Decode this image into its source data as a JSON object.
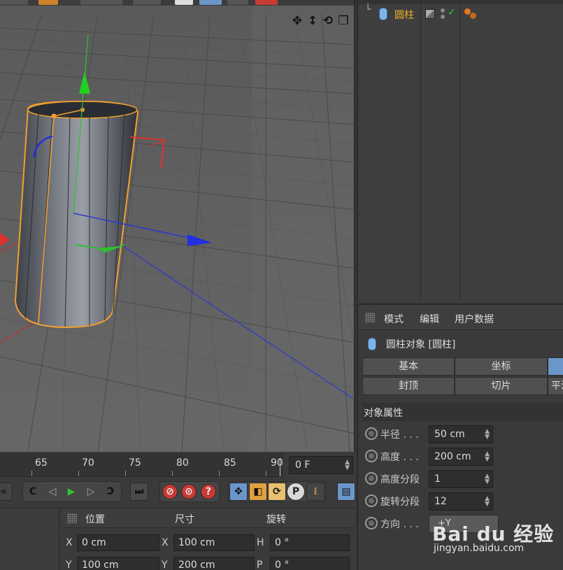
{
  "timeline": {
    "ticks": [
      "65",
      "70",
      "75",
      "80",
      "85",
      "90"
    ],
    "frame": "0 F"
  },
  "coords": {
    "headers": {
      "position": "位置",
      "size": "尺寸",
      "rotation": "旋转"
    },
    "rows": [
      {
        "pos_axis": "X",
        "pos_value": "0 cm",
        "size_axis": "X",
        "size_value": "100 cm",
        "rot_axis": "H",
        "rot_value": "0 °"
      },
      {
        "pos_axis": "Y",
        "pos_value": "100 cm",
        "size_axis": "Y",
        "size_value": "200 cm",
        "rot_axis": "P",
        "rot_value": "0 °"
      }
    ]
  },
  "object_manager": {
    "object_name": "圆柱",
    "checkmark": "✓"
  },
  "attributes": {
    "menu": {
      "mode": "模式",
      "edit": "编辑",
      "user_data": "用户数据"
    },
    "title": "圆柱对象 [圆柱]",
    "tabs_row1": [
      "基本",
      "坐标",
      ""
    ],
    "tabs_row2": [
      "封顶",
      "切片",
      "平滑"
    ],
    "section": "对象属性",
    "params": [
      {
        "label": "半径 . . .",
        "value": "50 cm"
      },
      {
        "label": "高度 . . .",
        "value": "200 cm"
      },
      {
        "label": "高度分段",
        "value": "1"
      },
      {
        "label": "旋转分段",
        "value": "12"
      },
      {
        "label": "方向 . . .",
        "value": "+Y"
      }
    ]
  },
  "watermark": {
    "brand": "Bai du 经验",
    "url": "jingyan.baidu.com"
  },
  "colors": {
    "accent_blue": "#6b96c9",
    "selection_orange": "#f0a030",
    "axis_red": "#e03030",
    "axis_green": "#30c030",
    "axis_blue": "#2a3ad0"
  }
}
